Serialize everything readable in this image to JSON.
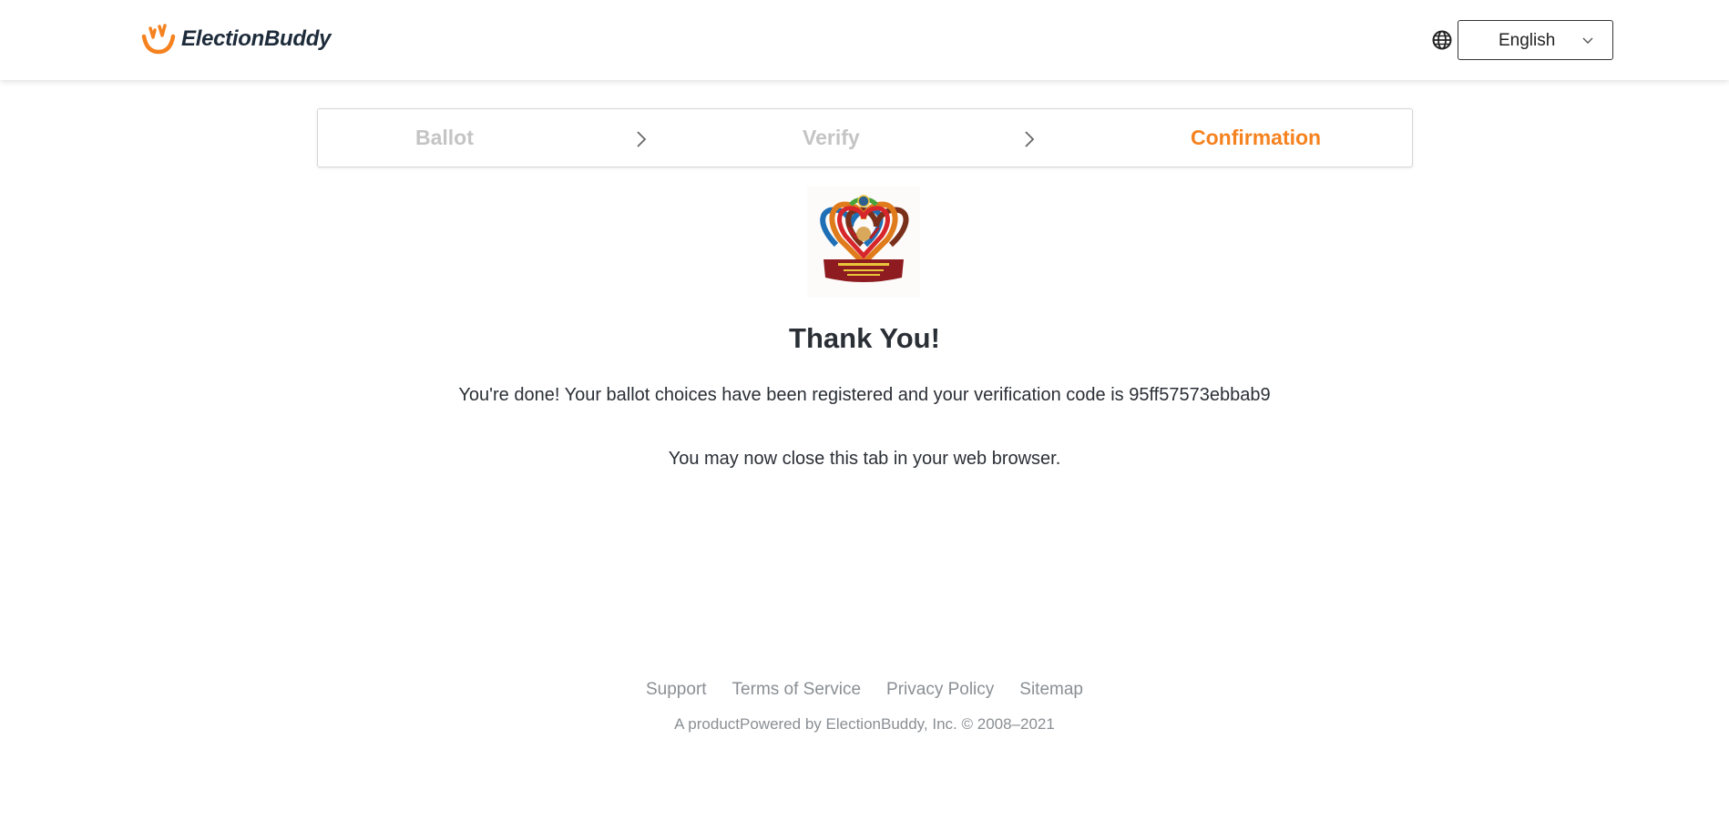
{
  "header": {
    "brand": "ElectionBuddy",
    "language": {
      "selected": "English"
    }
  },
  "steps": [
    {
      "label": "Ballot",
      "state": "inactive"
    },
    {
      "label": "Verify",
      "state": "inactive"
    },
    {
      "label": "Confirmation",
      "state": "active"
    }
  ],
  "main": {
    "title": "Thank You!",
    "message": "You're done! Your ballot choices have been registered and your verification code is 95ff57573ebbab9",
    "close_note": "You may now close this tab in your web browser."
  },
  "footer": {
    "links": [
      "Support",
      "Terms of Service",
      "Privacy Policy",
      "Sitemap"
    ],
    "copyright": "A productPowered by ElectionBuddy, Inc. © 2008–2021"
  },
  "colors": {
    "accent": "#f5821f",
    "inactive_step": "#c4c4c4",
    "text": "#2a2f36",
    "muted": "#8a8f94"
  },
  "icons": {
    "logo": "electionbuddy-logo-icon",
    "globe": "globe-icon",
    "dropdown": "chevron-down-icon",
    "step_separator": "chevron-right-icon"
  }
}
